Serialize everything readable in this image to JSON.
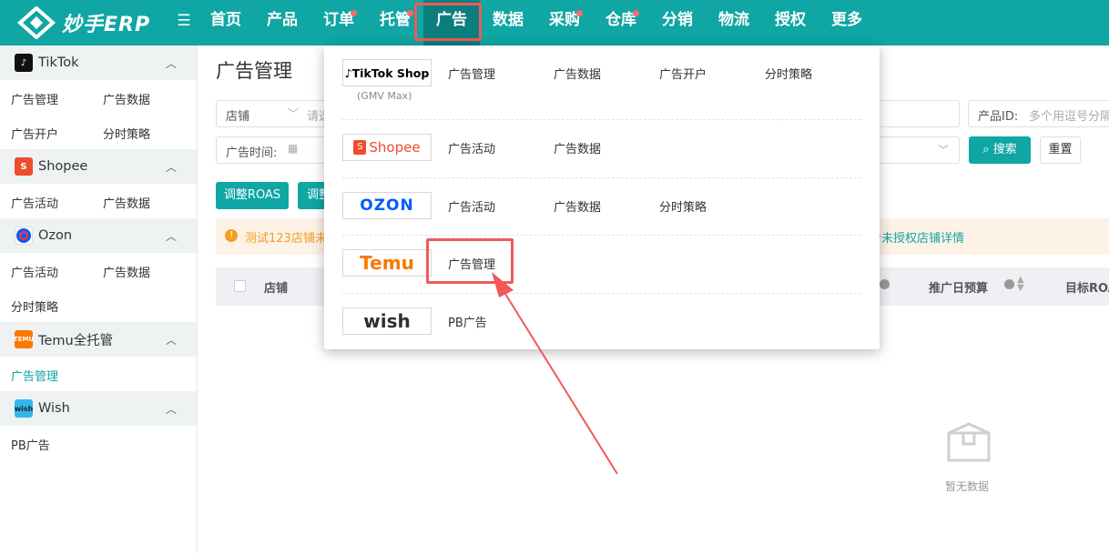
{
  "app": {
    "logo_text": "妙手ERP",
    "nav": [
      {
        "label": "首页",
        "dot": false
      },
      {
        "label": "产品",
        "dot": false
      },
      {
        "label": "订单",
        "dot": true
      },
      {
        "label": "托管",
        "dot": true
      },
      {
        "label": "广告",
        "dot": false,
        "active": true
      },
      {
        "label": "数据",
        "dot": false
      },
      {
        "label": "采购",
        "dot": true
      },
      {
        "label": "仓库",
        "dot": true
      },
      {
        "label": "分销",
        "dot": false
      },
      {
        "label": "物流",
        "dot": false
      },
      {
        "label": "授权",
        "dot": false
      },
      {
        "label": "更多",
        "dot": false
      }
    ]
  },
  "sidebar": {
    "sections": [
      {
        "label": "TikTok",
        "icon": "tiktok-icon",
        "links": [
          "广告管理",
          "广告数据",
          "广告开户",
          "分时策略"
        ]
      },
      {
        "label": "Shopee",
        "icon": "shopee-icon",
        "links": [
          "广告活动",
          "广告数据"
        ]
      },
      {
        "label": "Ozon",
        "icon": "ozon-icon",
        "links": [
          "广告活动",
          "广告数据",
          "分时策略"
        ]
      },
      {
        "label": "Temu全托管",
        "icon": "temu-icon",
        "links": [
          "广告管理"
        ]
      },
      {
        "label": "Wish",
        "icon": "wish-icon",
        "links": [
          "PB广告"
        ]
      }
    ]
  },
  "main": {
    "title": "广告管理",
    "filters": {
      "store_select": "店铺",
      "store_input_placeholder": "请选",
      "product_id_label": "产品ID:",
      "product_id_placeholder": "多个用逗号分隔",
      "ad_time_label": "广告时间:",
      "search_button": "搜索",
      "reset_button": "重置"
    },
    "actions": {
      "adjust_roas": "调整ROAS",
      "adjust_partial": "调整"
    },
    "alert": {
      "left_text": "测试123店铺未",
      "right_text": "看未授权店铺详情"
    },
    "table": {
      "headers": [
        "店铺",
        "推广日预算",
        "目标ROA"
      ]
    },
    "empty_text": "暂无数据"
  },
  "dropdown": {
    "platforms": [
      {
        "brand": "TikTok Shop",
        "sub": "(GMV Max)",
        "links": [
          "广告管理",
          "广告数据",
          "广告开户",
          "分时策略"
        ]
      },
      {
        "brand": "Shopee",
        "links": [
          "广告活动",
          "广告数据"
        ]
      },
      {
        "brand": "OZON",
        "links": [
          "广告活动",
          "广告数据",
          "分时策略"
        ]
      },
      {
        "brand": "Temu",
        "links": [
          "广告管理"
        ]
      },
      {
        "brand": "wish",
        "links": [
          "PB广告"
        ]
      }
    ]
  },
  "colors": {
    "brand_teal": "#0fa6a3",
    "nav_active": "#0b7f7e",
    "highlight_red": "#ef5a5a",
    "shopee_orange": "#ee4d2d",
    "ozon_blue": "#005bff",
    "temu_orange": "#fb7701"
  }
}
